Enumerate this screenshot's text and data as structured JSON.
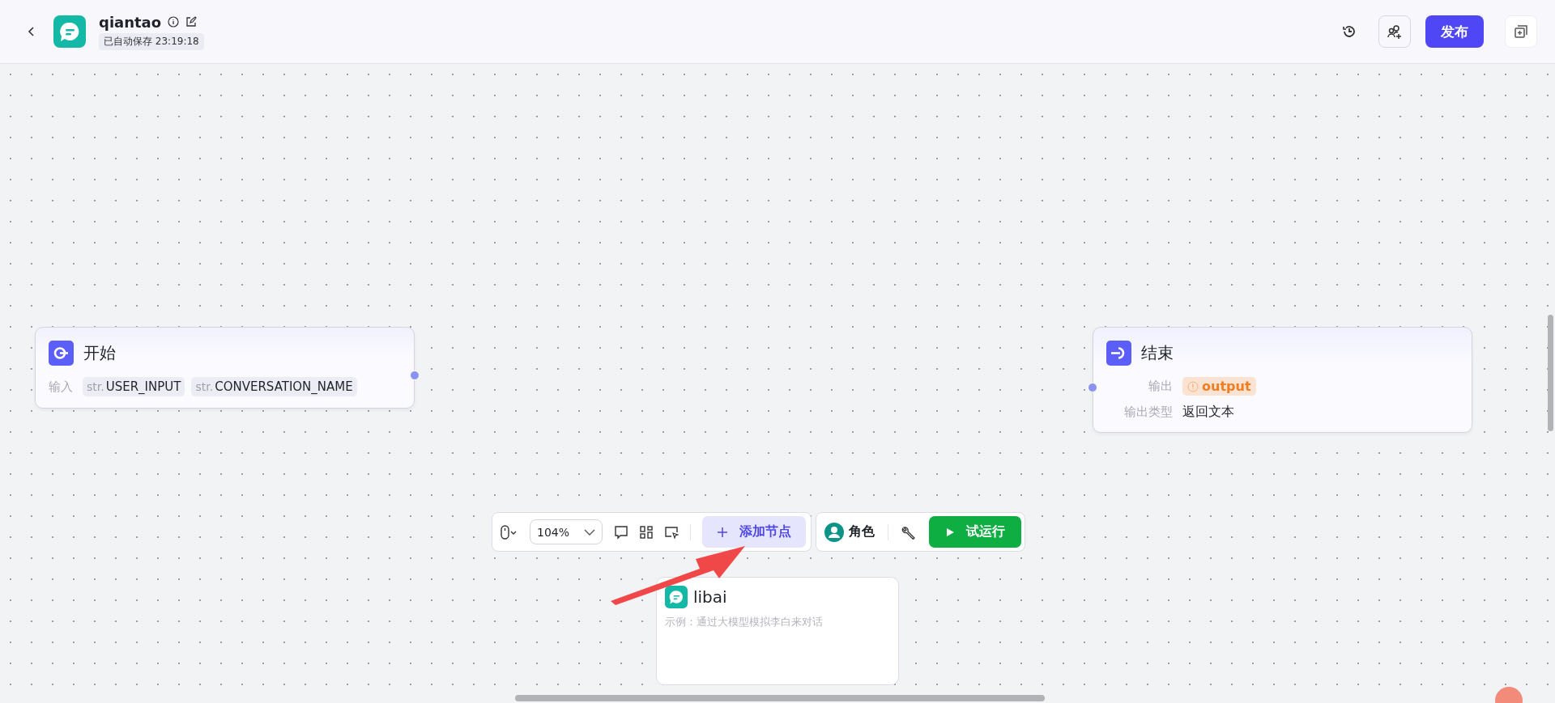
{
  "header": {
    "title": "qiantao",
    "autosave": "已自动保存 23:19:18",
    "publish": "发布"
  },
  "nodes": [
    {
      "kind": "start",
      "title": "开始",
      "label": "输入",
      "tags": [
        {
          "prefix": "str.",
          "name": "USER_INPUT"
        },
        {
          "prefix": "str.",
          "name": "CONVERSATION_NAME"
        }
      ]
    },
    {
      "kind": "end",
      "title": "结束",
      "rows": [
        {
          "kind": "warning",
          "label": "输出",
          "value": "output"
        },
        {
          "kind": "text",
          "label": "输出类型",
          "value": "返回文本"
        }
      ]
    }
  ],
  "toolbar": {
    "zoom": "104%",
    "add_node": "添加节点",
    "role": "角色",
    "run": "试运行"
  },
  "popup": {
    "name": "libai",
    "description": "示例：通过大模型模拟李白来对话"
  }
}
